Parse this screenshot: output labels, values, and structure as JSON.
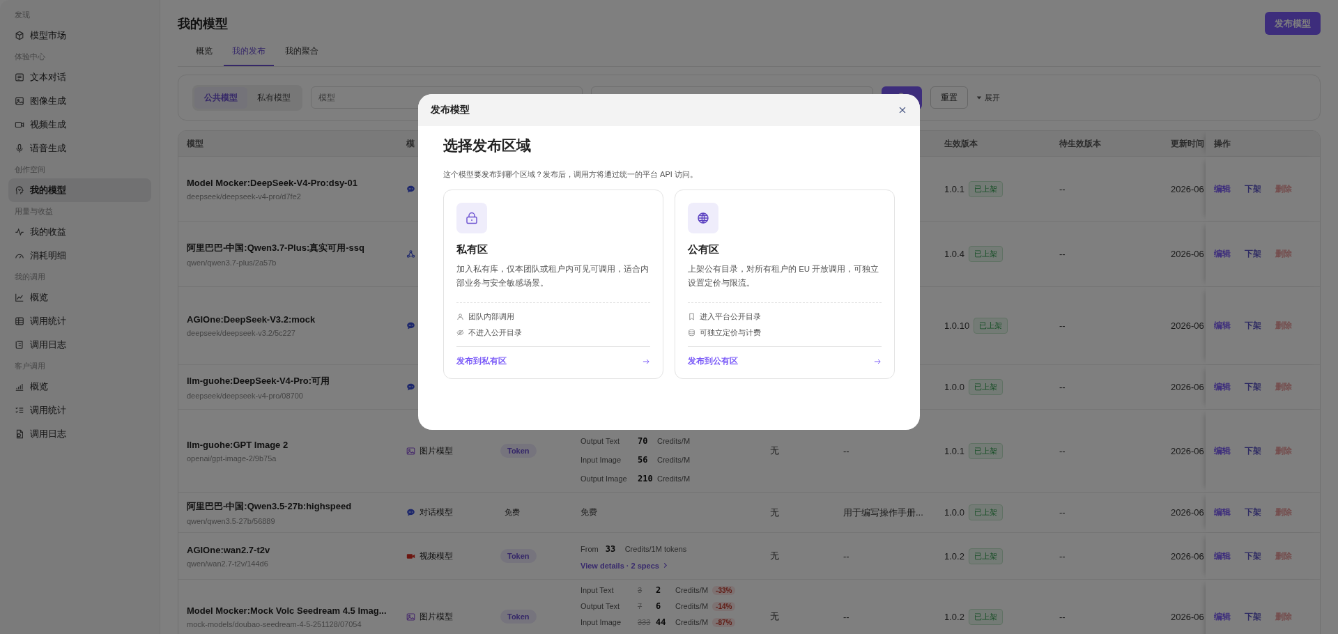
{
  "sidebar": {
    "sections": [
      {
        "heading": "发现",
        "items": [
          {
            "label": "模型市场",
            "selected": false
          }
        ]
      },
      {
        "heading": "体验中心",
        "items": [
          {
            "label": "文本对话",
            "selected": false
          },
          {
            "label": "图像生成",
            "selected": false
          },
          {
            "label": "视频生成",
            "selected": false
          },
          {
            "label": "语音生成",
            "selected": false
          }
        ]
      },
      {
        "heading": "创作空间",
        "items": [
          {
            "label": "我的模型",
            "selected": true
          }
        ]
      },
      {
        "heading": "用量与收益",
        "items": [
          {
            "label": "我的收益",
            "selected": false
          },
          {
            "label": "消耗明细",
            "selected": false
          }
        ]
      },
      {
        "heading": "我的调用",
        "items": [
          {
            "label": "概览",
            "selected": false
          },
          {
            "label": "调用统计",
            "selected": false
          },
          {
            "label": "调用日志",
            "selected": false
          }
        ]
      },
      {
        "heading": "客户调用",
        "items": [
          {
            "label": "概览",
            "selected": false
          },
          {
            "label": "调用统计",
            "selected": false
          },
          {
            "label": "调用日志",
            "selected": false
          }
        ]
      }
    ]
  },
  "page": {
    "title": "我的模型",
    "publish_button": "发布模型"
  },
  "tabs": [
    {
      "label": "概览",
      "selected": false
    },
    {
      "label": "我的发布",
      "selected": true
    },
    {
      "label": "我的聚合",
      "selected": false
    }
  ],
  "filters": {
    "scope": [
      {
        "label": "公共模型",
        "selected": true
      },
      {
        "label": "私有模型",
        "selected": false
      }
    ],
    "search": {
      "placeholder": "模型"
    },
    "reset_button": "重置",
    "expand": "展开"
  },
  "table": {
    "columns": [
      "模型",
      "模",
      "",
      "",
      "",
      "",
      "生效版本",
      "待生效版本",
      "更新时间",
      "操作"
    ],
    "rows": [
      {
        "name": "Model Mocker:DeepSeek-V4-Pro:dsy-01",
        "path": "deepseek/deepseek-v4-pro/d7fe2",
        "type": {
          "kind": "chat"
        },
        "version": "1.0.1",
        "status": "已上架",
        "pending": "--",
        "updated": "2026-06",
        "actions": [
          {
            "kind": "edit",
            "label": "编辑"
          },
          {
            "kind": "unlist",
            "label": "下架"
          },
          {
            "kind": "delete",
            "label": "删除"
          }
        ]
      },
      {
        "name": "阿里巴巴-中国:Qwen3.7-Plus:真实可用-ssq",
        "path": "qwen/qwen3.7-plus/2a57b",
        "type": {
          "kind": "agent"
        },
        "version": "1.0.4",
        "status": "已上架",
        "pending": "--",
        "updated": "2026-06",
        "actions": [
          {
            "kind": "edit",
            "label": "编辑"
          },
          {
            "kind": "unlist",
            "label": "下架"
          },
          {
            "kind": "delete",
            "label": "删除"
          }
        ]
      },
      {
        "name": "AGIOne:DeepSeek-V3.2:mock",
        "path": "deepseek/deepseek-v3.2/5c227",
        "type": {
          "kind": "chat"
        },
        "version": "1.0.10",
        "status": "已上架",
        "pending": "--",
        "updated": "2026-06",
        "actions": [
          {
            "kind": "edit",
            "label": "编辑"
          },
          {
            "kind": "unlist",
            "label": "下架"
          },
          {
            "kind": "delete",
            "label": "删除"
          }
        ]
      },
      {
        "name": "llm-guohe:DeepSeek-V4-Pro:可用",
        "path": "deepseek/deepseek-v4-pro/08700",
        "type": {
          "kind": "chat"
        },
        "version": "1.0.0",
        "status": "已上架",
        "pending": "--",
        "updated": "2026-06",
        "actions": [
          {
            "kind": "edit",
            "label": "编辑"
          },
          {
            "kind": "unlist",
            "label": "下架"
          },
          {
            "kind": "delete",
            "label": "删除"
          }
        ]
      },
      {
        "name": "llm-guohe:GPT Image 2",
        "path": "openai/gpt-image-2/9b75a",
        "type": {
          "kind": "image",
          "label": "图片模型"
        },
        "billing": {
          "kind": "tag",
          "label": "Token"
        },
        "price": {
          "kind": "lines",
          "lines": [
            {
              "label": "Output Text",
              "value": "70",
              "unit": "Credits/M"
            },
            {
              "label": "Input Image",
              "value": "56",
              "unit": "Credits/M"
            },
            {
              "label": "Output Image",
              "value": "210",
              "unit": "Credits/M"
            }
          ]
        },
        "column_5": "无",
        "column_6": "--",
        "version": "1.0.1",
        "status": "已上架",
        "pending": "--",
        "updated": "2026-06",
        "actions": [
          {
            "kind": "edit",
            "label": "编辑"
          },
          {
            "kind": "unlist",
            "label": "下架"
          },
          {
            "kind": "delete",
            "label": "删除"
          }
        ]
      },
      {
        "name": "阿里巴巴-中国:Qwen3.5-27b:highspeed",
        "path": "qwen/qwen3.5-27b/56889",
        "type": {
          "kind": "chat",
          "label": "对话模型"
        },
        "billing": {
          "kind": "plain",
          "label": "免费"
        },
        "price": {
          "kind": "text",
          "text": "免费"
        },
        "column_5": "无",
        "column_6": "用于编写操作手册...",
        "version": "1.0.0",
        "status": "已上架",
        "pending": "--",
        "updated": "2026-06",
        "actions": [
          {
            "kind": "edit",
            "label": "编辑"
          },
          {
            "kind": "unlist",
            "label": "下架"
          },
          {
            "kind": "delete",
            "label": "删除"
          }
        ]
      },
      {
        "name": "AGIOne:wan2.7-t2v",
        "path": "qwen/wan2.7-t2v/144d6",
        "type": {
          "kind": "video",
          "label": "视频模型"
        },
        "billing": {
          "kind": "tag",
          "label": "Token"
        },
        "price": {
          "kind": "from",
          "prefix": "From",
          "value": "33",
          "unit": "Credits/1M tokens",
          "link": "View details · 2 specs"
        },
        "column_5": "无",
        "column_6": "--",
        "version": "1.0.2",
        "status": "已上架",
        "pending": "--",
        "updated": "2026-06",
        "actions": [
          {
            "kind": "edit",
            "label": "编辑"
          },
          {
            "kind": "unlist",
            "label": "下架"
          },
          {
            "kind": "delete",
            "label": "删除"
          }
        ]
      },
      {
        "name": "Model Mocker:Mock Volc Seedream 4.5 Imag...",
        "path": "mock-models/doubao-seedream-4-5-251128/07054",
        "type": {
          "kind": "image",
          "label": "图片模型"
        },
        "billing": {
          "kind": "tag",
          "label": "Token"
        },
        "price": {
          "kind": "lines",
          "lines": [
            {
              "label": "Input Text",
              "was": "3",
              "value": "2",
              "unit": "Credits/M",
              "discount": "-33%"
            },
            {
              "label": "Output Text",
              "was": "7",
              "value": "6",
              "unit": "Credits/M",
              "discount": "-14%"
            },
            {
              "label": "Input Image",
              "was": "333",
              "value": "44",
              "unit": "Credits/M",
              "discount": "-87%"
            }
          ]
        },
        "column_5": "无",
        "column_6": "--",
        "version": "1.0.2",
        "status": "已上架",
        "pending": "--",
        "updated": "2026-06",
        "actions": [
          {
            "kind": "edit",
            "label": "编辑"
          },
          {
            "kind": "unlist",
            "label": "下架"
          },
          {
            "kind": "delete",
            "label": "删除"
          }
        ]
      }
    ]
  },
  "dialog": {
    "title": "发布模型",
    "heading": "选择发布区域",
    "description": "这个模型要发布到哪个区域？发布后，调用方将通过统一的平台 API 访问。",
    "options": [
      {
        "kind": "private",
        "title": "私有区",
        "description": "加入私有库，仅本团队或租户内可见可调用，适合内部业务与安全敏感场景。",
        "features": [
          "团队内部调用",
          "不进入公开目录"
        ],
        "action": "发布到私有区"
      },
      {
        "kind": "public",
        "title": "公有区",
        "description": "上架公有目录，对所有租户的 EU 开放调用，可独立设置定价与限流。",
        "features": [
          "进入平台公开目录",
          "可独立定价与计费"
        ],
        "action": "发布到公有区"
      }
    ]
  }
}
